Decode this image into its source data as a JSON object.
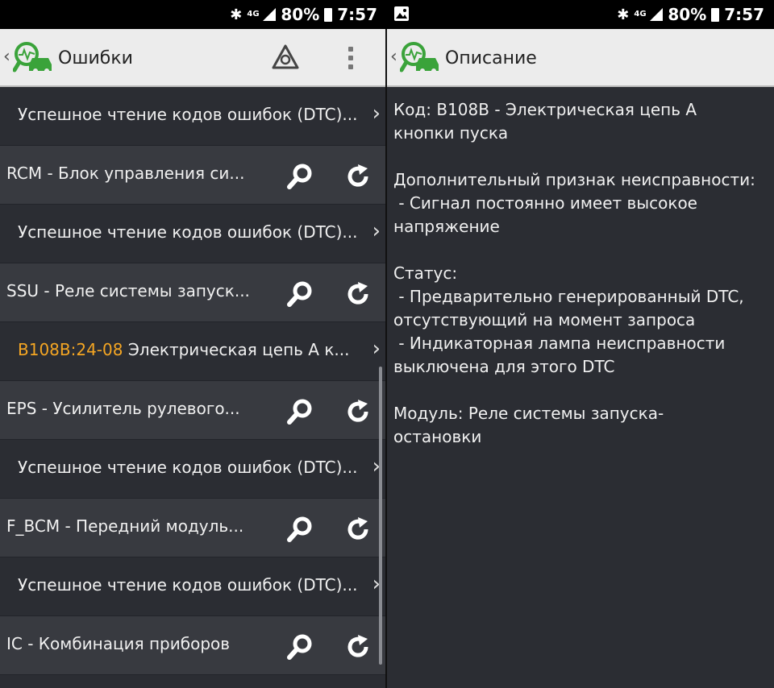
{
  "status_bar": {
    "battery": "80%",
    "time": "7:57",
    "network": "4G"
  },
  "left": {
    "title": "Ошибки",
    "rows": [
      {
        "type": "result",
        "text": "Успешное чтение кодов ошибок (DTC)..."
      },
      {
        "type": "module",
        "text": "RCM - Блок управления си..."
      },
      {
        "type": "result",
        "text": "Успешное чтение кодов ошибок (DTC)..."
      },
      {
        "type": "module",
        "text": "SSU - Реле системы запуск..."
      },
      {
        "type": "dtc",
        "code": "B108B:24-08",
        "text": " Электрическая цепь A к..."
      },
      {
        "type": "module",
        "text": "EPS - Усилитель рулевого..."
      },
      {
        "type": "result",
        "text": "Успешное чтение кодов ошибок (DTC)..."
      },
      {
        "type": "module",
        "text": "F_BCM - Передний модуль..."
      },
      {
        "type": "result",
        "text": "Успешное чтение кодов ошибок (DTC)..."
      },
      {
        "type": "module",
        "text": "IC - Комбинация приборов"
      }
    ]
  },
  "right": {
    "title": "Описание",
    "description": "Код: B108B - Электрическая цепь A\nкнопки пуска\n\nДополнительный признак неисправности:\n - Сигнал постоянно имеет высокое\nнапряжение\n\nСтатус:\n - Предварительно генерированный DTC,\nотсутствующий на момент запроса\n - Индикаторная лампа неисправности\nвыключена для этого DTC\n\nМодуль: Реле системы запуска-\nостановки"
  },
  "colors": {
    "accent_green": "#3aa33a",
    "dtc_code": "#f5a623",
    "list_bg": "#2b2d33",
    "module_row_bg": "#383a40"
  }
}
